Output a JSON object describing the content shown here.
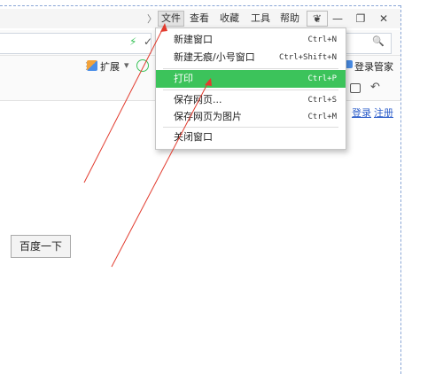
{
  "menubar": {
    "chevron": "〉",
    "items": [
      "文件",
      "查看",
      "收藏",
      "工具",
      "帮助"
    ],
    "window_buttons": [
      "❦",
      "—",
      "❐",
      "✕"
    ]
  },
  "address": {
    "bolt": "⚡",
    "check": "✓",
    "search_icon": "🔍"
  },
  "toolbar": {
    "extensions_label": "扩展",
    "dropdown_arrow": "▾",
    "account_label": "登录管家",
    "login_link": "登录",
    "register_link": "注册"
  },
  "file_menu": {
    "items": [
      {
        "label": "新建窗口",
        "shortcut": "Ctrl+N"
      },
      {
        "label": "新建无痕/小号窗口",
        "shortcut": "Ctrl+Shift+N"
      },
      {
        "label": "打印",
        "shortcut": "Ctrl+P"
      },
      {
        "label": "保存网页...",
        "shortcut": "Ctrl+S"
      },
      {
        "label": "保存网页为图片",
        "shortcut": "Ctrl+M"
      },
      {
        "label": "关闭窗口",
        "shortcut": ""
      }
    ]
  },
  "page": {
    "search_button": "百度一下"
  },
  "colors": {
    "highlight": "#3cc35b",
    "annotation_arrow": "#e23b2e",
    "link": "#2b5cc9"
  }
}
